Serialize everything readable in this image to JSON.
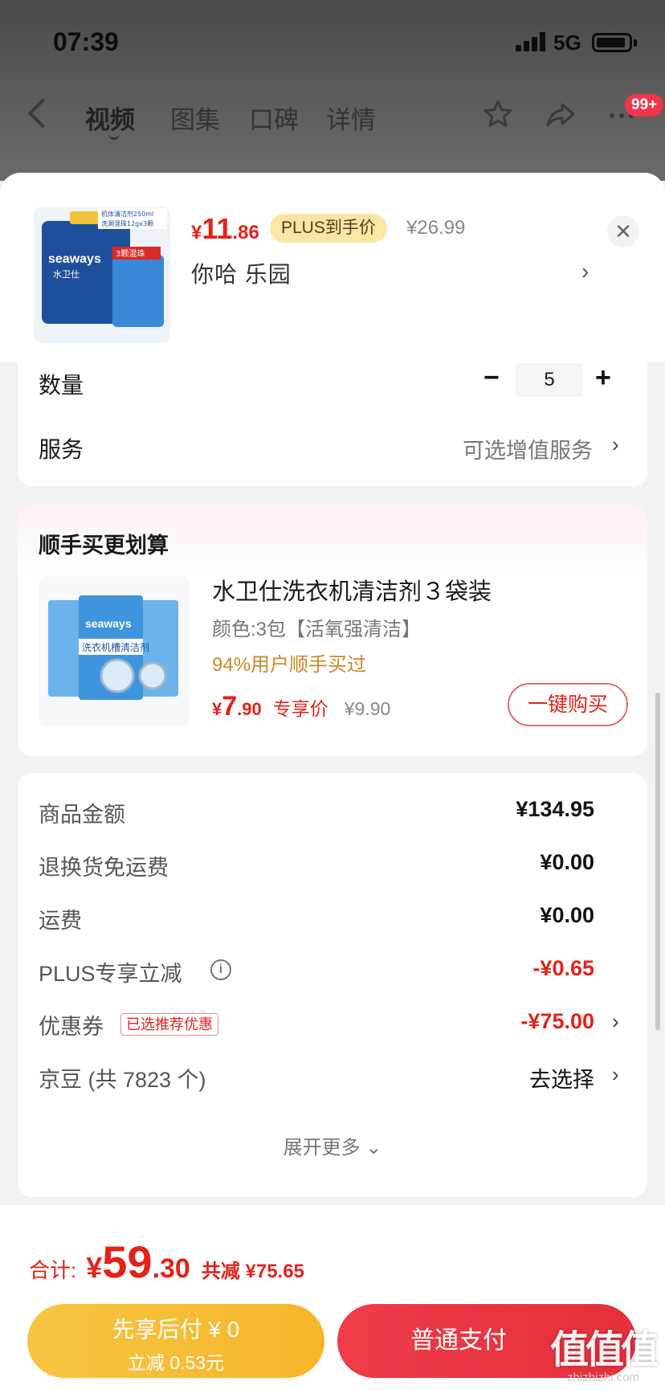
{
  "status_bar": {
    "time": "07:39",
    "network": "5G"
  },
  "nav": {
    "tabs": [
      "视频",
      "图集",
      "口碑",
      "详情"
    ],
    "badge": "99+",
    "icons": [
      "back-icon",
      "star-icon",
      "share-icon",
      "more-icon"
    ]
  },
  "product": {
    "price_symbol": "¥",
    "price_int": "11",
    "price_dec": ".86",
    "plus_tag": "PLUS到手价",
    "original_price": "¥26.99",
    "spec": "你哈  乐园",
    "brand": "seaways",
    "brand_cn": "水卫仕",
    "image_lines": [
      "机体清洁剂250ml",
      "洗涮混珠12gx3颗",
      "3颗混珠"
    ]
  },
  "quantity": {
    "label": "数量",
    "value": "5",
    "minus": "−",
    "plus": "+"
  },
  "service": {
    "label": "服务",
    "value": "可选增值服务"
  },
  "bundle": {
    "title": "顺手买更划算",
    "name": "水卫仕洗衣机清洁剂３袋装",
    "spec": "颜色:3包【活氧强清洁】",
    "percent_text": "94%用户顺手买过",
    "price_symbol": "¥",
    "price_int": "7",
    "price_dec": ".90",
    "price_tag": "专享价",
    "original_price": "¥9.90",
    "buy_label": "一键购买",
    "image_brand": "seaways",
    "image_text": "洗衣机槽清洁剂"
  },
  "summary": {
    "rows": [
      {
        "label": "商品金额",
        "value": "¥134.95"
      },
      {
        "label": "退换货免运费",
        "value": "¥0.00"
      },
      {
        "label": "运费",
        "value": "¥0.00"
      },
      {
        "label": "PLUS专享立减",
        "value": "-¥0.65"
      },
      {
        "label": "优惠券",
        "value": "-¥75.00",
        "tag": "已选推荐优惠"
      },
      {
        "label": "京豆 (共 7823 个)",
        "value": "去选择"
      }
    ],
    "info_icon": "i",
    "expand_label": "展开更多"
  },
  "footer": {
    "total_label": "合计:",
    "total_symbol": "¥",
    "total_int": "59",
    "total_dec": ".30",
    "saved": "共减 ¥75.65",
    "later_pay_line1": "先享后付 ¥ 0",
    "later_pay_line2": "立减 0.53元",
    "pay_label": "普通支付"
  },
  "watermark": {
    "logo": "值值值",
    "url": "zhizhizhi.com"
  },
  "colors": {
    "accent_red": "#e2231a",
    "plus_gold": "#fbe6a6",
    "later_pay_yellow": "#f7c543",
    "pay_red": "#ee3d4a"
  }
}
